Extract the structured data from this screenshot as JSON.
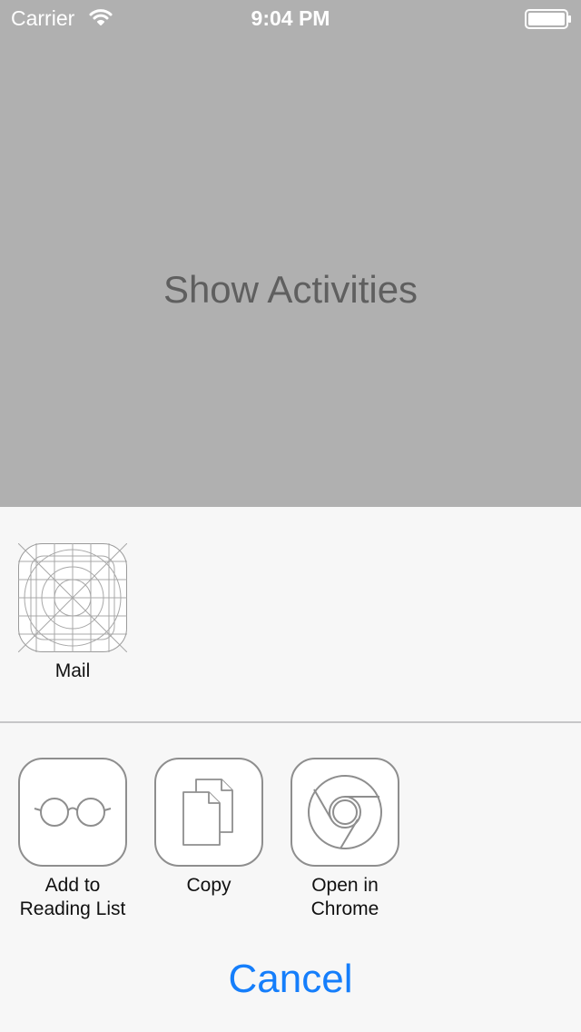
{
  "status_bar": {
    "carrier": "Carrier",
    "time": "9:04 PM"
  },
  "background": {
    "title": "Show Activities"
  },
  "share_row": {
    "items": [
      {
        "label": "Mail",
        "icon": "mail-placeholder-icon"
      }
    ]
  },
  "action_row": {
    "items": [
      {
        "label": "Add to\nReading List",
        "icon": "glasses-icon"
      },
      {
        "label": "Copy",
        "icon": "copy-icon"
      },
      {
        "label": "Open in\nChrome",
        "icon": "chrome-icon"
      }
    ]
  },
  "cancel": {
    "label": "Cancel"
  },
  "colors": {
    "accent": "#157efb",
    "backdrop": "#b0b0b0",
    "sheet": "#f7f7f7"
  }
}
